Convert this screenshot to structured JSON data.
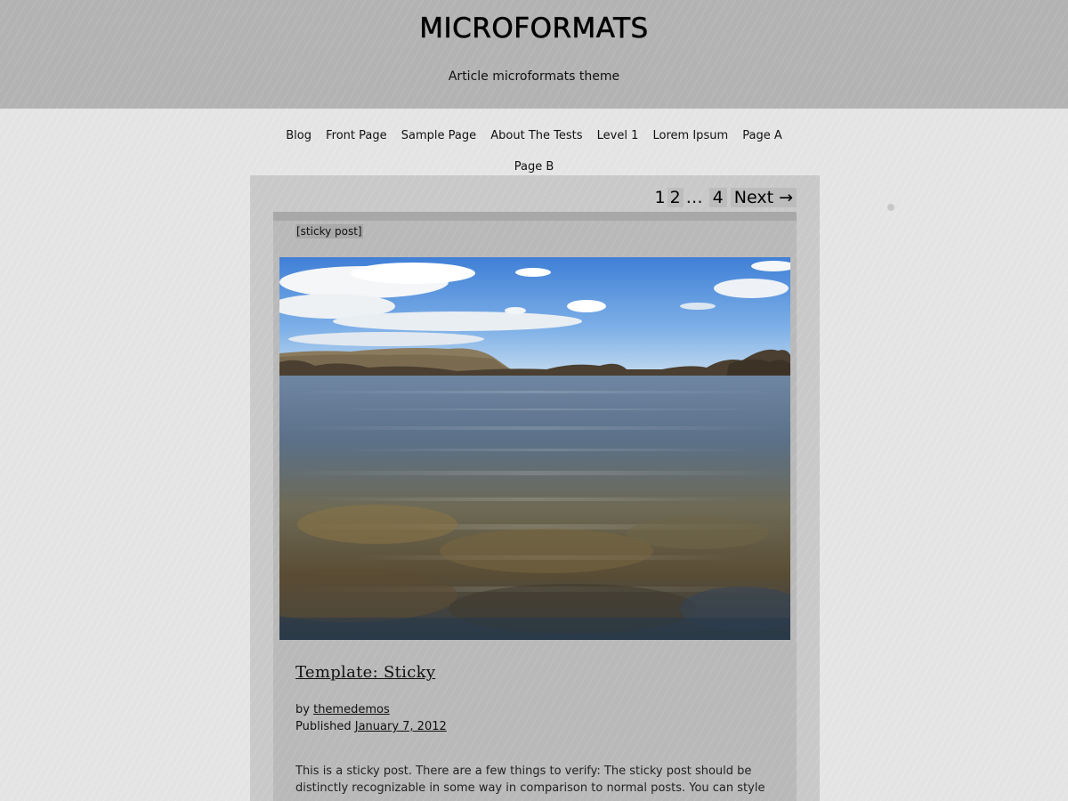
{
  "site": {
    "title": "MICROFORMATS",
    "description": "Article microformats theme"
  },
  "nav": {
    "items": [
      {
        "label": "Blog"
      },
      {
        "label": "Front Page"
      },
      {
        "label": "Sample Page"
      },
      {
        "label": "About The Tests"
      },
      {
        "label": "Level 1"
      },
      {
        "label": "Lorem Ipsum"
      },
      {
        "label": "Page A"
      },
      {
        "label": "Page B"
      }
    ]
  },
  "pagination": {
    "page1": "1",
    "page2": "2",
    "dots": "…",
    "page4": "4",
    "next": "Next →"
  },
  "post": {
    "sticky_label": "[sticky post]",
    "title": "Template: Sticky",
    "by_prefix": "by",
    "author": "themedemos",
    "published_prefix": "Published",
    "date": "January 7, 2012",
    "body": "This is a sticky post. There are a few things to verify: The sticky post should be distinctly recognizable in some way in comparison to normal posts. You can style the .sticky",
    "image_name": "featured-image"
  }
}
